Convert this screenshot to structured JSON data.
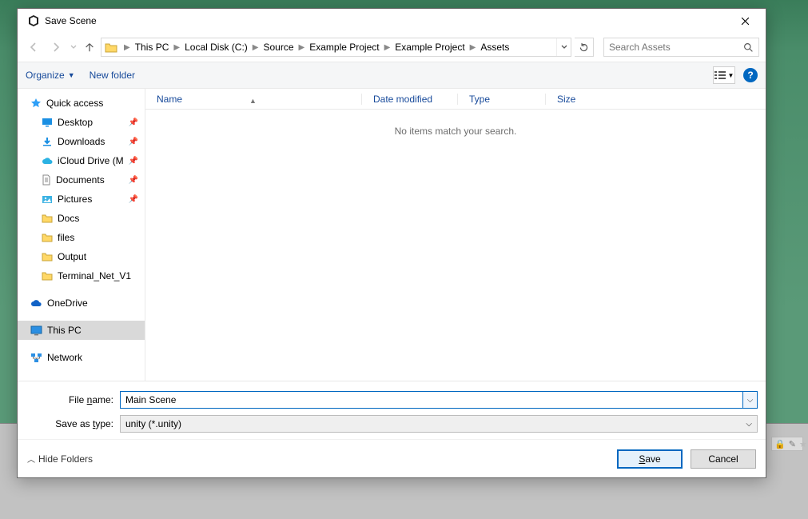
{
  "title": "Save Scene",
  "breadcrumbs": [
    "This PC",
    "Local Disk (C:)",
    "Source",
    "Example Project",
    "Example Project",
    "Assets"
  ],
  "search": {
    "placeholder": "Search Assets"
  },
  "toolbar": {
    "organize": "Organize",
    "new_folder": "New folder"
  },
  "columns": {
    "name": "Name",
    "date": "Date modified",
    "type": "Type",
    "size": "Size"
  },
  "empty_message": "No items match your search.",
  "tree": {
    "quick_access": "Quick access",
    "pinned": [
      {
        "label": "Desktop",
        "icon": "desktop"
      },
      {
        "label": "Downloads",
        "icon": "download"
      },
      {
        "label": "iCloud Drive (Ma",
        "icon": "icloud"
      },
      {
        "label": "Documents",
        "icon": "document"
      },
      {
        "label": "Pictures",
        "icon": "picture"
      }
    ],
    "folders": [
      {
        "label": "Docs"
      },
      {
        "label": "files"
      },
      {
        "label": "Output"
      },
      {
        "label": "Terminal_Net_V1"
      }
    ],
    "onedrive": "OneDrive",
    "this_pc": "This PC",
    "network": "Network"
  },
  "file_name_label_pre": "File ",
  "file_name_label_ul": "n",
  "file_name_label_post": "ame:",
  "file_name_value": "Main Scene",
  "save_type_label_pre": "Save as ",
  "save_type_label_ul": "t",
  "save_type_label_post": "ype:",
  "save_type_value": "unity (*.unity)",
  "hide_folders": "Hide Folders",
  "buttons": {
    "save_ul": "S",
    "save_rest": "ave",
    "cancel": "Cancel"
  }
}
